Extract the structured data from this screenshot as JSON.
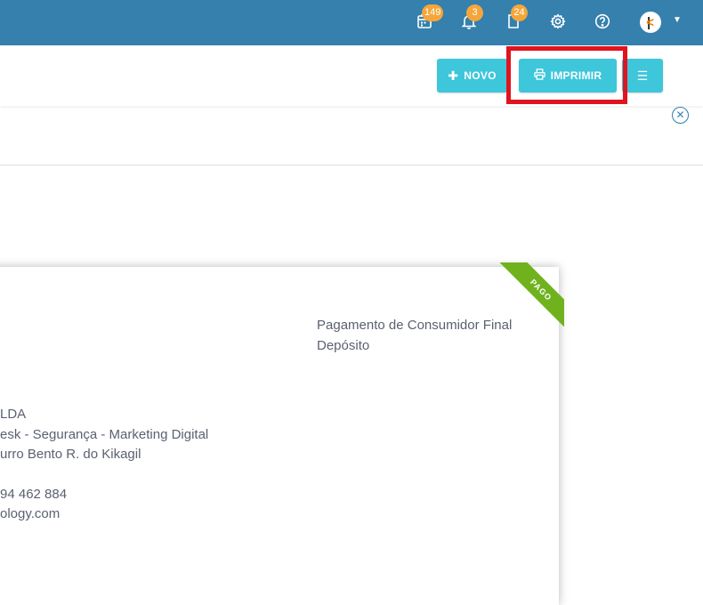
{
  "topbar": {
    "badges": {
      "calendar": "149",
      "notifications": "3",
      "documents": "24"
    }
  },
  "toolbar": {
    "novo_label": "NOVO",
    "imprimir_label": "IMPRIMIR"
  },
  "document": {
    "status_ribbon": "PAGO",
    "payment_type": "Pagamento de Consumidor Final",
    "payment_method": "Depósito",
    "company_lines": [
      "LDA",
      "esk - Segurança - Marketing Digital",
      "urro Bento R. do Kikagil"
    ],
    "contact_lines": [
      "94 462 884",
      "ology.com"
    ]
  },
  "colors": {
    "topbar": "#3580ad",
    "button": "#3ec6db",
    "badge": "#f5a63a",
    "ribbon": "#6fb21e",
    "highlight": "#e0141f"
  }
}
